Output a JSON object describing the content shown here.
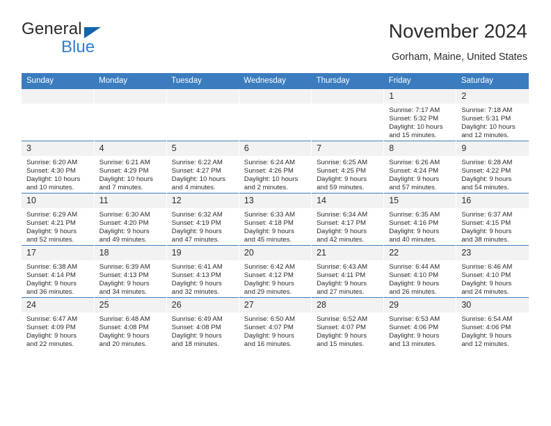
{
  "brand": {
    "word_one": "General",
    "word_two": "Blue",
    "triangle_icon": "blue-triangle-icon",
    "accent_color": "#2d7dd2"
  },
  "header": {
    "title": "November 2024",
    "subtitle": "Gorham, Maine, United States",
    "header_bg_color": "#3a7cbe"
  },
  "weekday_headers": [
    "Sunday",
    "Monday",
    "Tuesday",
    "Wednesday",
    "Thursday",
    "Friday",
    "Saturday"
  ],
  "labels": {
    "sunrise_prefix": "Sunrise:",
    "sunset_prefix": "Sunset:",
    "daylight_prefix": "Daylight:"
  },
  "weeks": [
    [
      {
        "day": "",
        "sunrise": "",
        "sunset": "",
        "daylight_line1": "",
        "daylight_line2": ""
      },
      {
        "day": "",
        "sunrise": "",
        "sunset": "",
        "daylight_line1": "",
        "daylight_line2": ""
      },
      {
        "day": "",
        "sunrise": "",
        "sunset": "",
        "daylight_line1": "",
        "daylight_line2": ""
      },
      {
        "day": "",
        "sunrise": "",
        "sunset": "",
        "daylight_line1": "",
        "daylight_line2": ""
      },
      {
        "day": "",
        "sunrise": "",
        "sunset": "",
        "daylight_line1": "",
        "daylight_line2": ""
      },
      {
        "day": "1",
        "sunrise": "Sunrise: 7:17 AM",
        "sunset": "Sunset: 5:32 PM",
        "daylight_line1": "Daylight: 10 hours",
        "daylight_line2": "and 15 minutes."
      },
      {
        "day": "2",
        "sunrise": "Sunrise: 7:18 AM",
        "sunset": "Sunset: 5:31 PM",
        "daylight_line1": "Daylight: 10 hours",
        "daylight_line2": "and 12 minutes."
      }
    ],
    [
      {
        "day": "3",
        "sunrise": "Sunrise: 6:20 AM",
        "sunset": "Sunset: 4:30 PM",
        "daylight_line1": "Daylight: 10 hours",
        "daylight_line2": "and 10 minutes."
      },
      {
        "day": "4",
        "sunrise": "Sunrise: 6:21 AM",
        "sunset": "Sunset: 4:29 PM",
        "daylight_line1": "Daylight: 10 hours",
        "daylight_line2": "and 7 minutes."
      },
      {
        "day": "5",
        "sunrise": "Sunrise: 6:22 AM",
        "sunset": "Sunset: 4:27 PM",
        "daylight_line1": "Daylight: 10 hours",
        "daylight_line2": "and 4 minutes."
      },
      {
        "day": "6",
        "sunrise": "Sunrise: 6:24 AM",
        "sunset": "Sunset: 4:26 PM",
        "daylight_line1": "Daylight: 10 hours",
        "daylight_line2": "and 2 minutes."
      },
      {
        "day": "7",
        "sunrise": "Sunrise: 6:25 AM",
        "sunset": "Sunset: 4:25 PM",
        "daylight_line1": "Daylight: 9 hours",
        "daylight_line2": "and 59 minutes."
      },
      {
        "day": "8",
        "sunrise": "Sunrise: 6:26 AM",
        "sunset": "Sunset: 4:24 PM",
        "daylight_line1": "Daylight: 9 hours",
        "daylight_line2": "and 57 minutes."
      },
      {
        "day": "9",
        "sunrise": "Sunrise: 6:28 AM",
        "sunset": "Sunset: 4:22 PM",
        "daylight_line1": "Daylight: 9 hours",
        "daylight_line2": "and 54 minutes."
      }
    ],
    [
      {
        "day": "10",
        "sunrise": "Sunrise: 6:29 AM",
        "sunset": "Sunset: 4:21 PM",
        "daylight_line1": "Daylight: 9 hours",
        "daylight_line2": "and 52 minutes."
      },
      {
        "day": "11",
        "sunrise": "Sunrise: 6:30 AM",
        "sunset": "Sunset: 4:20 PM",
        "daylight_line1": "Daylight: 9 hours",
        "daylight_line2": "and 49 minutes."
      },
      {
        "day": "12",
        "sunrise": "Sunrise: 6:32 AM",
        "sunset": "Sunset: 4:19 PM",
        "daylight_line1": "Daylight: 9 hours",
        "daylight_line2": "and 47 minutes."
      },
      {
        "day": "13",
        "sunrise": "Sunrise: 6:33 AM",
        "sunset": "Sunset: 4:18 PM",
        "daylight_line1": "Daylight: 9 hours",
        "daylight_line2": "and 45 minutes."
      },
      {
        "day": "14",
        "sunrise": "Sunrise: 6:34 AM",
        "sunset": "Sunset: 4:17 PM",
        "daylight_line1": "Daylight: 9 hours",
        "daylight_line2": "and 42 minutes."
      },
      {
        "day": "15",
        "sunrise": "Sunrise: 6:35 AM",
        "sunset": "Sunset: 4:16 PM",
        "daylight_line1": "Daylight: 9 hours",
        "daylight_line2": "and 40 minutes."
      },
      {
        "day": "16",
        "sunrise": "Sunrise: 6:37 AM",
        "sunset": "Sunset: 4:15 PM",
        "daylight_line1": "Daylight: 9 hours",
        "daylight_line2": "and 38 minutes."
      }
    ],
    [
      {
        "day": "17",
        "sunrise": "Sunrise: 6:38 AM",
        "sunset": "Sunset: 4:14 PM",
        "daylight_line1": "Daylight: 9 hours",
        "daylight_line2": "and 36 minutes."
      },
      {
        "day": "18",
        "sunrise": "Sunrise: 6:39 AM",
        "sunset": "Sunset: 4:13 PM",
        "daylight_line1": "Daylight: 9 hours",
        "daylight_line2": "and 34 minutes."
      },
      {
        "day": "19",
        "sunrise": "Sunrise: 6:41 AM",
        "sunset": "Sunset: 4:13 PM",
        "daylight_line1": "Daylight: 9 hours",
        "daylight_line2": "and 32 minutes."
      },
      {
        "day": "20",
        "sunrise": "Sunrise: 6:42 AM",
        "sunset": "Sunset: 4:12 PM",
        "daylight_line1": "Daylight: 9 hours",
        "daylight_line2": "and 29 minutes."
      },
      {
        "day": "21",
        "sunrise": "Sunrise: 6:43 AM",
        "sunset": "Sunset: 4:11 PM",
        "daylight_line1": "Daylight: 9 hours",
        "daylight_line2": "and 27 minutes."
      },
      {
        "day": "22",
        "sunrise": "Sunrise: 6:44 AM",
        "sunset": "Sunset: 4:10 PM",
        "daylight_line1": "Daylight: 9 hours",
        "daylight_line2": "and 26 minutes."
      },
      {
        "day": "23",
        "sunrise": "Sunrise: 6:46 AM",
        "sunset": "Sunset: 4:10 PM",
        "daylight_line1": "Daylight: 9 hours",
        "daylight_line2": "and 24 minutes."
      }
    ],
    [
      {
        "day": "24",
        "sunrise": "Sunrise: 6:47 AM",
        "sunset": "Sunset: 4:09 PM",
        "daylight_line1": "Daylight: 9 hours",
        "daylight_line2": "and 22 minutes."
      },
      {
        "day": "25",
        "sunrise": "Sunrise: 6:48 AM",
        "sunset": "Sunset: 4:08 PM",
        "daylight_line1": "Daylight: 9 hours",
        "daylight_line2": "and 20 minutes."
      },
      {
        "day": "26",
        "sunrise": "Sunrise: 6:49 AM",
        "sunset": "Sunset: 4:08 PM",
        "daylight_line1": "Daylight: 9 hours",
        "daylight_line2": "and 18 minutes."
      },
      {
        "day": "27",
        "sunrise": "Sunrise: 6:50 AM",
        "sunset": "Sunset: 4:07 PM",
        "daylight_line1": "Daylight: 9 hours",
        "daylight_line2": "and 16 minutes."
      },
      {
        "day": "28",
        "sunrise": "Sunrise: 6:52 AM",
        "sunset": "Sunset: 4:07 PM",
        "daylight_line1": "Daylight: 9 hours",
        "daylight_line2": "and 15 minutes."
      },
      {
        "day": "29",
        "sunrise": "Sunrise: 6:53 AM",
        "sunset": "Sunset: 4:06 PM",
        "daylight_line1": "Daylight: 9 hours",
        "daylight_line2": "and 13 minutes."
      },
      {
        "day": "30",
        "sunrise": "Sunrise: 6:54 AM",
        "sunset": "Sunset: 4:06 PM",
        "daylight_line1": "Daylight: 9 hours",
        "daylight_line2": "and 12 minutes."
      }
    ]
  ]
}
